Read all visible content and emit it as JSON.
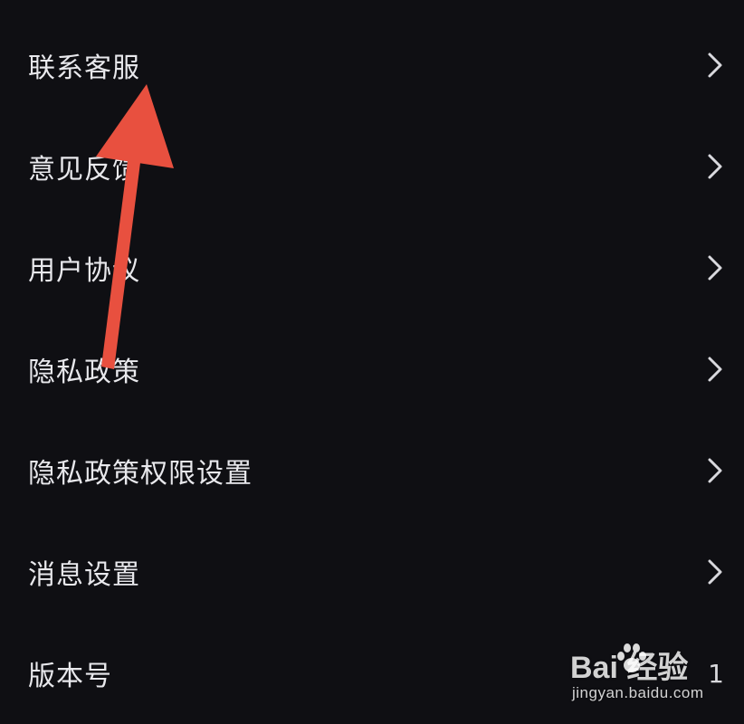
{
  "menu": {
    "items": [
      {
        "label": "联系客服"
      },
      {
        "label": "意见反馈"
      },
      {
        "label": "用户协议"
      },
      {
        "label": "隐私政策"
      },
      {
        "label": "隐私政策权限设置"
      },
      {
        "label": "消息设置"
      }
    ],
    "version": {
      "label": "版本号",
      "value": "1"
    }
  },
  "watermark": {
    "brand": "Bai  经验",
    "site": "jingyan.baidu.com"
  },
  "colors": {
    "background": "#0f0f13",
    "text": "#e8e8ec",
    "chevron": "#d9d9de",
    "annotation_arrow": "#e8503f"
  },
  "icons": {
    "row_chevron": "chevron-right-icon",
    "watermark_logo": "paw-icon"
  }
}
